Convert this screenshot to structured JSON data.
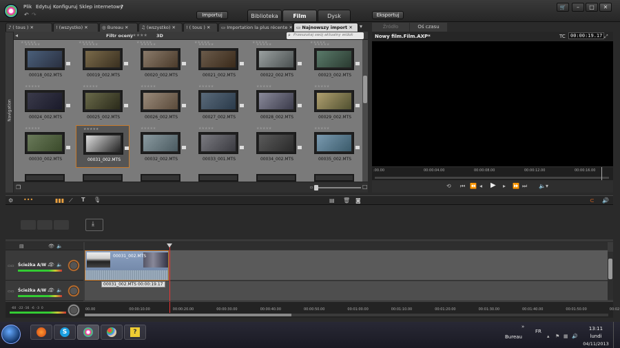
{
  "menu": {
    "file": "Plik",
    "edit": "Edytuj",
    "configure": "Konfiguruj",
    "store": "Sklep internetowy",
    "help": "?"
  },
  "top_buttons": {
    "import": "Importuj",
    "export": "Eksportuj"
  },
  "main_tabs": [
    "Biblioteka",
    "Film",
    "Dysk"
  ],
  "window_buttons": {
    "cart": "🛒",
    "minimize": "–",
    "maximize": "□",
    "close": "✕"
  },
  "library_tabs": [
    "( tous )",
    "(wszystko)",
    "Bureau",
    "(wszystko)",
    "( tous )",
    "Importation la plus récente",
    "Najnowszy import"
  ],
  "library_header": {
    "filter_label": "Filtr oceny",
    "stars": "★★★★★",
    "mode": "3D",
    "search_placeholder": "Przeszukaj swój aktualny widok"
  },
  "navigation_label": "Navigation",
  "clips": [
    "00018_002.MTS",
    "00019_002.MTS",
    "00020_002.MTS",
    "00021_002.MTS",
    "00022_002.MTS",
    "00023_002.MTS",
    "00024_002.MTS",
    "00025_002.MTS",
    "00026_002.MTS",
    "00027_002.MTS",
    "00028_002.MTS",
    "00029_002.MTS",
    "00030_002.MTS",
    "00031_002.MTS",
    "00032_002.MTS",
    "00033_001.MTS",
    "00034_002.MTS",
    "00035_002.MTS"
  ],
  "clip_stars": "★★★★★",
  "preview": {
    "tab_source": "Źródło",
    "tab_timeline": "Oś czasu",
    "title": "Nowy film.Film.AXP*",
    "tc_label": "TC",
    "timecode": "00:00:19.17"
  },
  "preview_ruler": [
    ":00.00",
    "00:00:04.00",
    "00:00:08.00",
    "00:00:12.00",
    "00:00:16.00"
  ],
  "tracks": [
    {
      "name": "Ścieżka A/W ..."
    },
    {
      "name": "Ścieżka A/W ..."
    }
  ],
  "timeline_clip": {
    "label": "00031_002.MTS",
    "tooltip": "00031_002.MTS  00:00:19.17"
  },
  "meter_scale": "-60  -22 -16  -6  -3  0",
  "timeline_ruler": [
    "00.00",
    "00:00:10.00",
    "00:00:20.00",
    "00:00:30.00",
    "00:00:40.00",
    "00:00:50.00",
    "00:01:00.00",
    "00:01:10.00",
    "00:01:20.00",
    "00:01:30.00",
    "00:01:40.00",
    "00:01:50.00",
    "00:02:00.00"
  ],
  "taskbar": {
    "folder": "Bureau",
    "chevron": "»",
    "lang": "FR",
    "time": "13:11",
    "day": "lundi",
    "date": "04/11/2013"
  },
  "colors": {
    "accent": "#c87a2a",
    "selection": "#d68a2e"
  }
}
